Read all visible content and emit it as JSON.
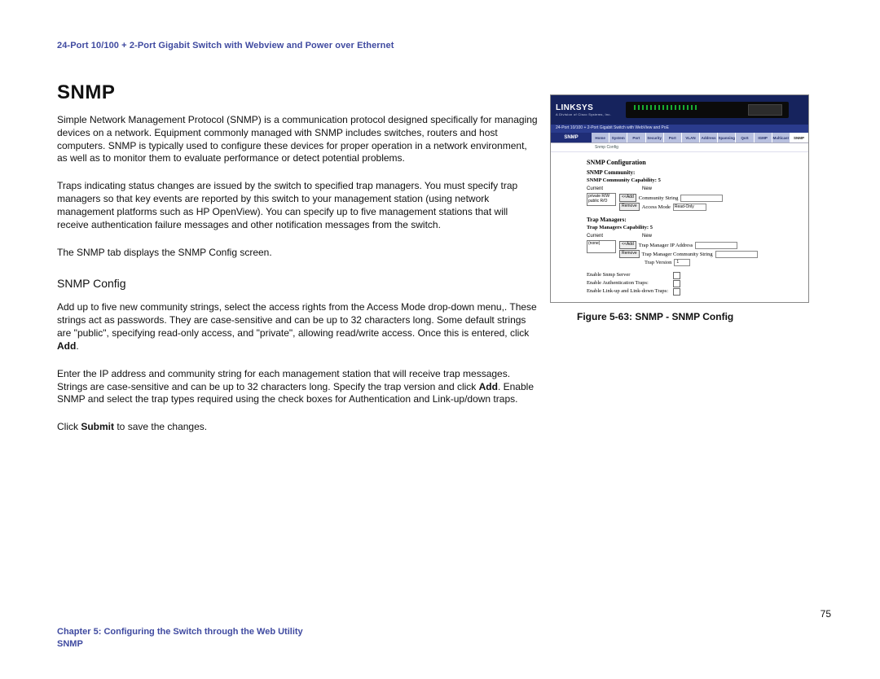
{
  "header": {
    "product_line": "24-Port 10/100 + 2-Port Gigabit Switch with Webview and Power over Ethernet"
  },
  "left": {
    "h1": "SNMP",
    "p1": "Simple Network Management Protocol (SNMP) is a communication protocol designed specifically for managing devices on a network. Equipment commonly managed with SNMP includes switches, routers and host computers. SNMP is typically used to configure these devices for proper operation in a network environment, as well as to monitor them to evaluate performance or detect potential problems.",
    "p2": "Traps indicating status changes are issued by the switch to specified trap managers. You must specify trap managers so that key events are reported by this switch to your management station (using network management platforms such as HP OpenView). You can specify up to five management stations that will receive authentication failure messages and other notification messages from the switch.",
    "p3": "The SNMP tab displays the SNMP Config screen.",
    "h2": "SNMP Config",
    "p4_a": "Add up to five new community strings, select the access rights from the Access Mode drop-down menu,. These strings act as passwords. They are case-sensitive and can be up to 32 characters long. Some default strings are \"public\", specifying read-only access, and \"private\", allowing read/write access. Once this is entered, click ",
    "p4_b": "Add",
    "p4_c": ".",
    "p5_a": "Enter the IP address and community string for each management station that will receive trap messages. Strings are case-sensitive and can be up to 32 characters long. Specify the trap version and click ",
    "p5_b": "Add",
    "p5_c": ". Enable SNMP and select the trap types required using the check boxes for Authentication and Link-up/down traps.",
    "p6_a": "Click ",
    "p6_b": "Submit",
    "p6_c": " to save the changes."
  },
  "figure": {
    "logo": "LINKSYS",
    "logo_sub": "A Division of Cisco Systems, Inc.",
    "subbar": "24-Port 10/100 + 2-Port Gigabit Switch with WebView and PoE",
    "nav_label": "SNMP",
    "tabs": [
      "Home",
      "System",
      "Port",
      "Security",
      "Port",
      "VLAN",
      "Address",
      "Spanning",
      "QoS",
      "IGMP",
      "Multicast",
      "SNMP"
    ],
    "sublink": "Snmp Config",
    "h": "SNMP Configuration",
    "sh1": "SNMP Community:",
    "cap_line": "SNMP Community Capability: 5",
    "col_current": "Current",
    "col_new": "New",
    "list_items": [
      "private R/W",
      "public  R/O"
    ],
    "btn_add": "<<Add",
    "btn_remove": "Remove",
    "lbl_commstr": "Community String",
    "lbl_accessmode": "Access Mode",
    "sel_readonly": "Read-Only",
    "sh2": "Trap Managers:",
    "tm_cap": "Trap Managers Capability: 5",
    "tm_none": "(none)",
    "lbl_tm_ip": "Trap Manager IP Address",
    "lbl_tm_cs": "Trap Manager Community String",
    "lbl_tm_ver": "Trap Version",
    "sel_tv": "1",
    "enable_snmp": "Enable Snmp Server",
    "enable_auth": "Enable Authentication Traps:",
    "enable_lul": "Enable Link-up and Link-down Traps:",
    "caption": "Figure 5-63: SNMP - SNMP Config"
  },
  "footer": {
    "page_num": "75",
    "chapter_line": "Chapter 5: Configuring the Switch through the Web Utility",
    "section_line": "SNMP"
  }
}
